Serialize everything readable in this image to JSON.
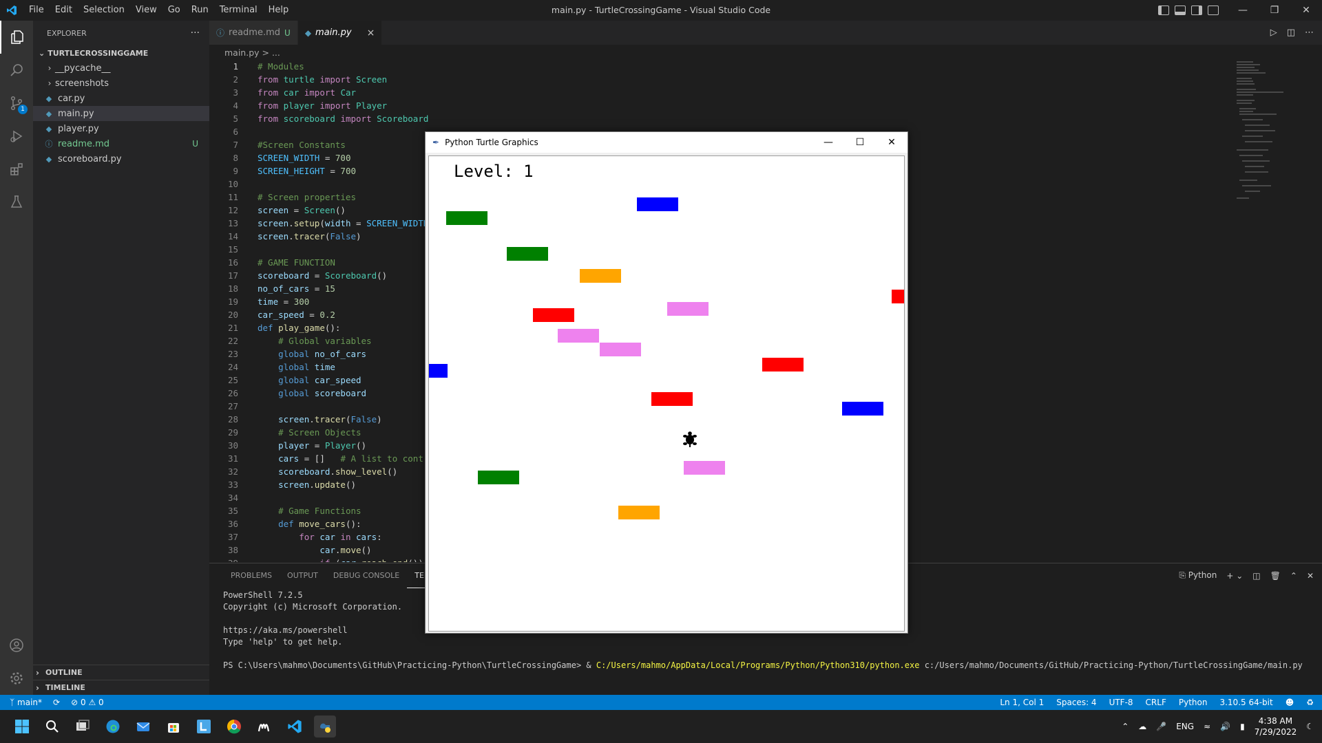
{
  "titlebar": {
    "menu": [
      "File",
      "Edit",
      "Selection",
      "View",
      "Go",
      "Run",
      "Terminal",
      "Help"
    ],
    "window_title": "main.py - TurtleCrossingGame - Visual Studio Code"
  },
  "sidebar": {
    "header": "EXPLORER",
    "more": "···",
    "folder": "TURTLECROSSINGGAME",
    "items": [
      {
        "label": "__pycache__",
        "type": "folder"
      },
      {
        "label": "screenshots",
        "type": "folder"
      },
      {
        "label": "car.py",
        "type": "py"
      },
      {
        "label": "main.py",
        "type": "py"
      },
      {
        "label": "player.py",
        "type": "py"
      },
      {
        "label": "readme.md",
        "type": "md",
        "badge": "U"
      },
      {
        "label": "scoreboard.py",
        "type": "py"
      }
    ],
    "outline": "OUTLINE",
    "timeline": "TIMELINE"
  },
  "activity": {
    "scm_badge": "1"
  },
  "tabs": [
    {
      "label": "readme.md",
      "modified": "U"
    },
    {
      "label": "main.py",
      "close": "×"
    }
  ],
  "breadcrumb": "main.py > ...",
  "code_lines": [
    {
      "n": "1"
    },
    {
      "n": "2"
    },
    {
      "n": "3"
    },
    {
      "n": "4"
    },
    {
      "n": "5"
    },
    {
      "n": "6"
    },
    {
      "n": "7"
    },
    {
      "n": "8"
    },
    {
      "n": "9"
    },
    {
      "n": "10"
    },
    {
      "n": "11"
    },
    {
      "n": "12"
    },
    {
      "n": "13"
    },
    {
      "n": "14"
    },
    {
      "n": "15"
    },
    {
      "n": "16"
    },
    {
      "n": "17"
    },
    {
      "n": "18"
    },
    {
      "n": "19"
    },
    {
      "n": "20"
    },
    {
      "n": "21"
    },
    {
      "n": "22"
    },
    {
      "n": "23"
    },
    {
      "n": "24"
    },
    {
      "n": "25"
    },
    {
      "n": "26"
    },
    {
      "n": "27"
    },
    {
      "n": "28"
    },
    {
      "n": "29"
    },
    {
      "n": "30"
    },
    {
      "n": "31"
    },
    {
      "n": "32"
    },
    {
      "n": "33"
    },
    {
      "n": "34"
    },
    {
      "n": "35"
    },
    {
      "n": "36"
    },
    {
      "n": "37"
    },
    {
      "n": "38"
    },
    {
      "n": "39"
    }
  ],
  "code": {
    "l1": "# Modules",
    "l7": "#Screen Constants",
    "l11": "# Screen properties",
    "l16": "# GAME FUNCTION",
    "l22": "# Global variables",
    "l29": "# Screen Objects",
    "l31c": "# A list to cont",
    "l35": "# Game Functions"
  },
  "panel": {
    "tabs": [
      "PROBLEMS",
      "OUTPUT",
      "DEBUG CONSOLE",
      "TERMINAL"
    ],
    "shell_label": "Python",
    "terminal": {
      "line1": "PowerShell 7.2.5",
      "line2": "Copyright (c) Microsoft Corporation.",
      "line3": "https://aka.ms/powershell",
      "line4": "Type 'help' to get help.",
      "prompt": "PS C:\\Users\\mahmo\\Documents\\GitHub\\Practicing-Python\\TurtleCrossingGame> & ",
      "exe": "C:/Users/mahmo/AppData/Local/Programs/Python/Python310/python.exe",
      "arg": " c:/Users/mahmo/Documents/GitHub/Practicing-Python/TurtleCrossingGame/main.py"
    }
  },
  "statusbar": {
    "branch": "main*",
    "errors": "0",
    "warnings": "0",
    "position": "Ln 1, Col 1",
    "spaces": "Spaces: 4",
    "encoding": "UTF-8",
    "eol": "CRLF",
    "language": "Python",
    "interpreter": "3.10.5 64-bit"
  },
  "turtle_window": {
    "title": "Python Turtle Graphics",
    "level_text": "Level: 1",
    "cars": [
      {
        "color": "#0000ff"
      },
      {
        "color": "#008000"
      },
      {
        "color": "#008000"
      },
      {
        "color": "#ffa500"
      },
      {
        "color": "#ff0000"
      },
      {
        "color": "#ee82ee"
      },
      {
        "color": "#ff0000"
      },
      {
        "color": "#ee82ee"
      },
      {
        "color": "#ee82ee"
      },
      {
        "color": "#0000ff"
      },
      {
        "color": "#ff0000"
      },
      {
        "color": "#ff0000"
      },
      {
        "color": "#0000ff"
      },
      {
        "color": "#ee82ee"
      },
      {
        "color": "#008000"
      },
      {
        "color": "#ffa500"
      }
    ]
  },
  "taskbar": {
    "lang": "ENG",
    "time": "4:38 AM",
    "date": "7/29/2022"
  },
  "colors": {
    "accent": "#007acc",
    "editor_bg": "#1e1e1e",
    "sidebar_bg": "#252526"
  }
}
